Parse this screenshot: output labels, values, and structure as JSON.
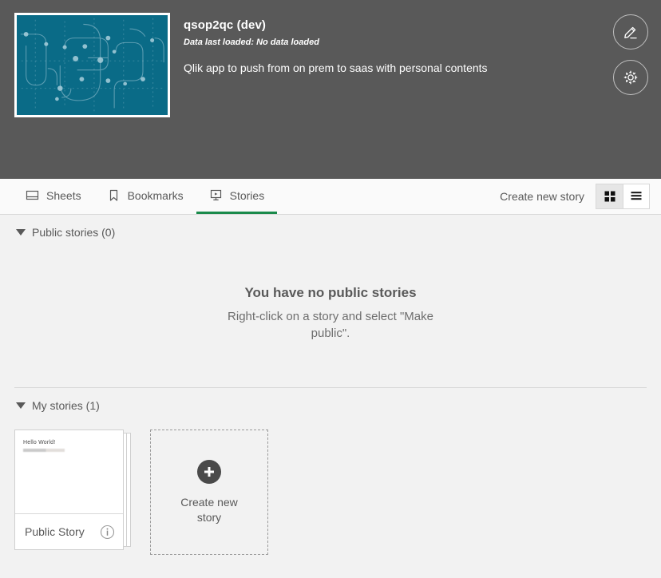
{
  "header": {
    "app_title": "qsop2qc (dev)",
    "data_loaded": "Data last loaded: No data loaded",
    "description": "Qlik app to push from on prem to saas with personal contents",
    "background_color": "#595959",
    "thumbnail_color": "#0a6b87",
    "edit_button_label": "edit-app",
    "settings_button_label": "app-settings"
  },
  "tabs": [
    {
      "label": "Sheets",
      "icon": "sheets-icon",
      "active": false
    },
    {
      "label": "Bookmarks",
      "icon": "bookmark-icon",
      "active": false
    },
    {
      "label": "Stories",
      "icon": "story-icon",
      "active": true
    }
  ],
  "toolbar": {
    "create_link": "Create new story",
    "grid_view_label": "grid-view",
    "list_view_label": "list-view",
    "active_view": "grid",
    "active_tab_color": "#1a8a4b"
  },
  "public_section": {
    "heading": "Public stories (0)",
    "empty_title": "You have no public stories",
    "empty_subtitle": "Right-click on a story and select \"Make public\"."
  },
  "my_section": {
    "heading": "My stories (1)",
    "stories": [
      {
        "name": "Public Story",
        "thumb_text": "Hello World!",
        "info_label": "story-info"
      }
    ],
    "create_tile_label": "Create new story"
  }
}
